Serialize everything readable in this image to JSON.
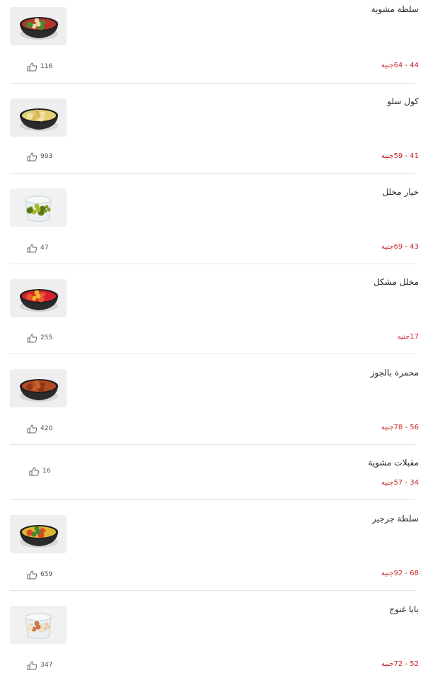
{
  "items": [
    {
      "name": "سلطة مشوية",
      "price": "44 - 64جنيه",
      "likes": "116",
      "has_image": true,
      "image_icon": "salad-bowl-icon",
      "colors": [
        "#b8352a",
        "#e8d9a8",
        "#4a8a2e"
      ]
    },
    {
      "name": "كول سلو",
      "price": "41 - 59جنيه",
      "likes": "993",
      "has_image": true,
      "image_icon": "coleslaw-bowl-icon",
      "colors": [
        "#e6cf78",
        "#d9b85a",
        "#f1e3a5"
      ]
    },
    {
      "name": "خيار مخلل",
      "price": "43 - 69جنيه",
      "likes": "47",
      "has_image": true,
      "image_icon": "pickles-container-icon",
      "colors": [
        "#7f9a1f",
        "#a6b92b",
        "#5c7612"
      ]
    },
    {
      "name": "مخلل مشكل",
      "price": "17جنيه",
      "likes": "255",
      "has_image": true,
      "image_icon": "mixed-pickles-bowl-icon",
      "colors": [
        "#d7222e",
        "#f2b52a",
        "#e85a2e"
      ]
    },
    {
      "name": "محمرة بالجوز",
      "price": "56 - 78جنيه",
      "likes": "420",
      "has_image": true,
      "image_icon": "muhammara-bowl-icon",
      "colors": [
        "#b24a22",
        "#c65f2e",
        "#8f3517"
      ]
    },
    {
      "name": "مقبلات مشوية",
      "price": "34 - 57جنيه",
      "likes": "16",
      "has_image": false
    },
    {
      "name": "سلطة جرجير",
      "price": "68 - 92جنيه",
      "likes": "659",
      "has_image": true,
      "image_icon": "arugula-salad-bowl-icon",
      "colors": [
        "#e0b52e",
        "#3f8a2b",
        "#d9462c"
      ]
    },
    {
      "name": "بابا غنوج",
      "price": "52 - 72جنيه",
      "likes": "347",
      "has_image": true,
      "image_icon": "baba-ganoush-container-icon",
      "colors": [
        "#e9c7a0",
        "#c9794a",
        "#f3e1c7"
      ]
    }
  ],
  "icons": {
    "like": "thumbs-up-icon"
  },
  "theme": {
    "price_color": "#c62828",
    "divider": "#e3e3e3"
  }
}
